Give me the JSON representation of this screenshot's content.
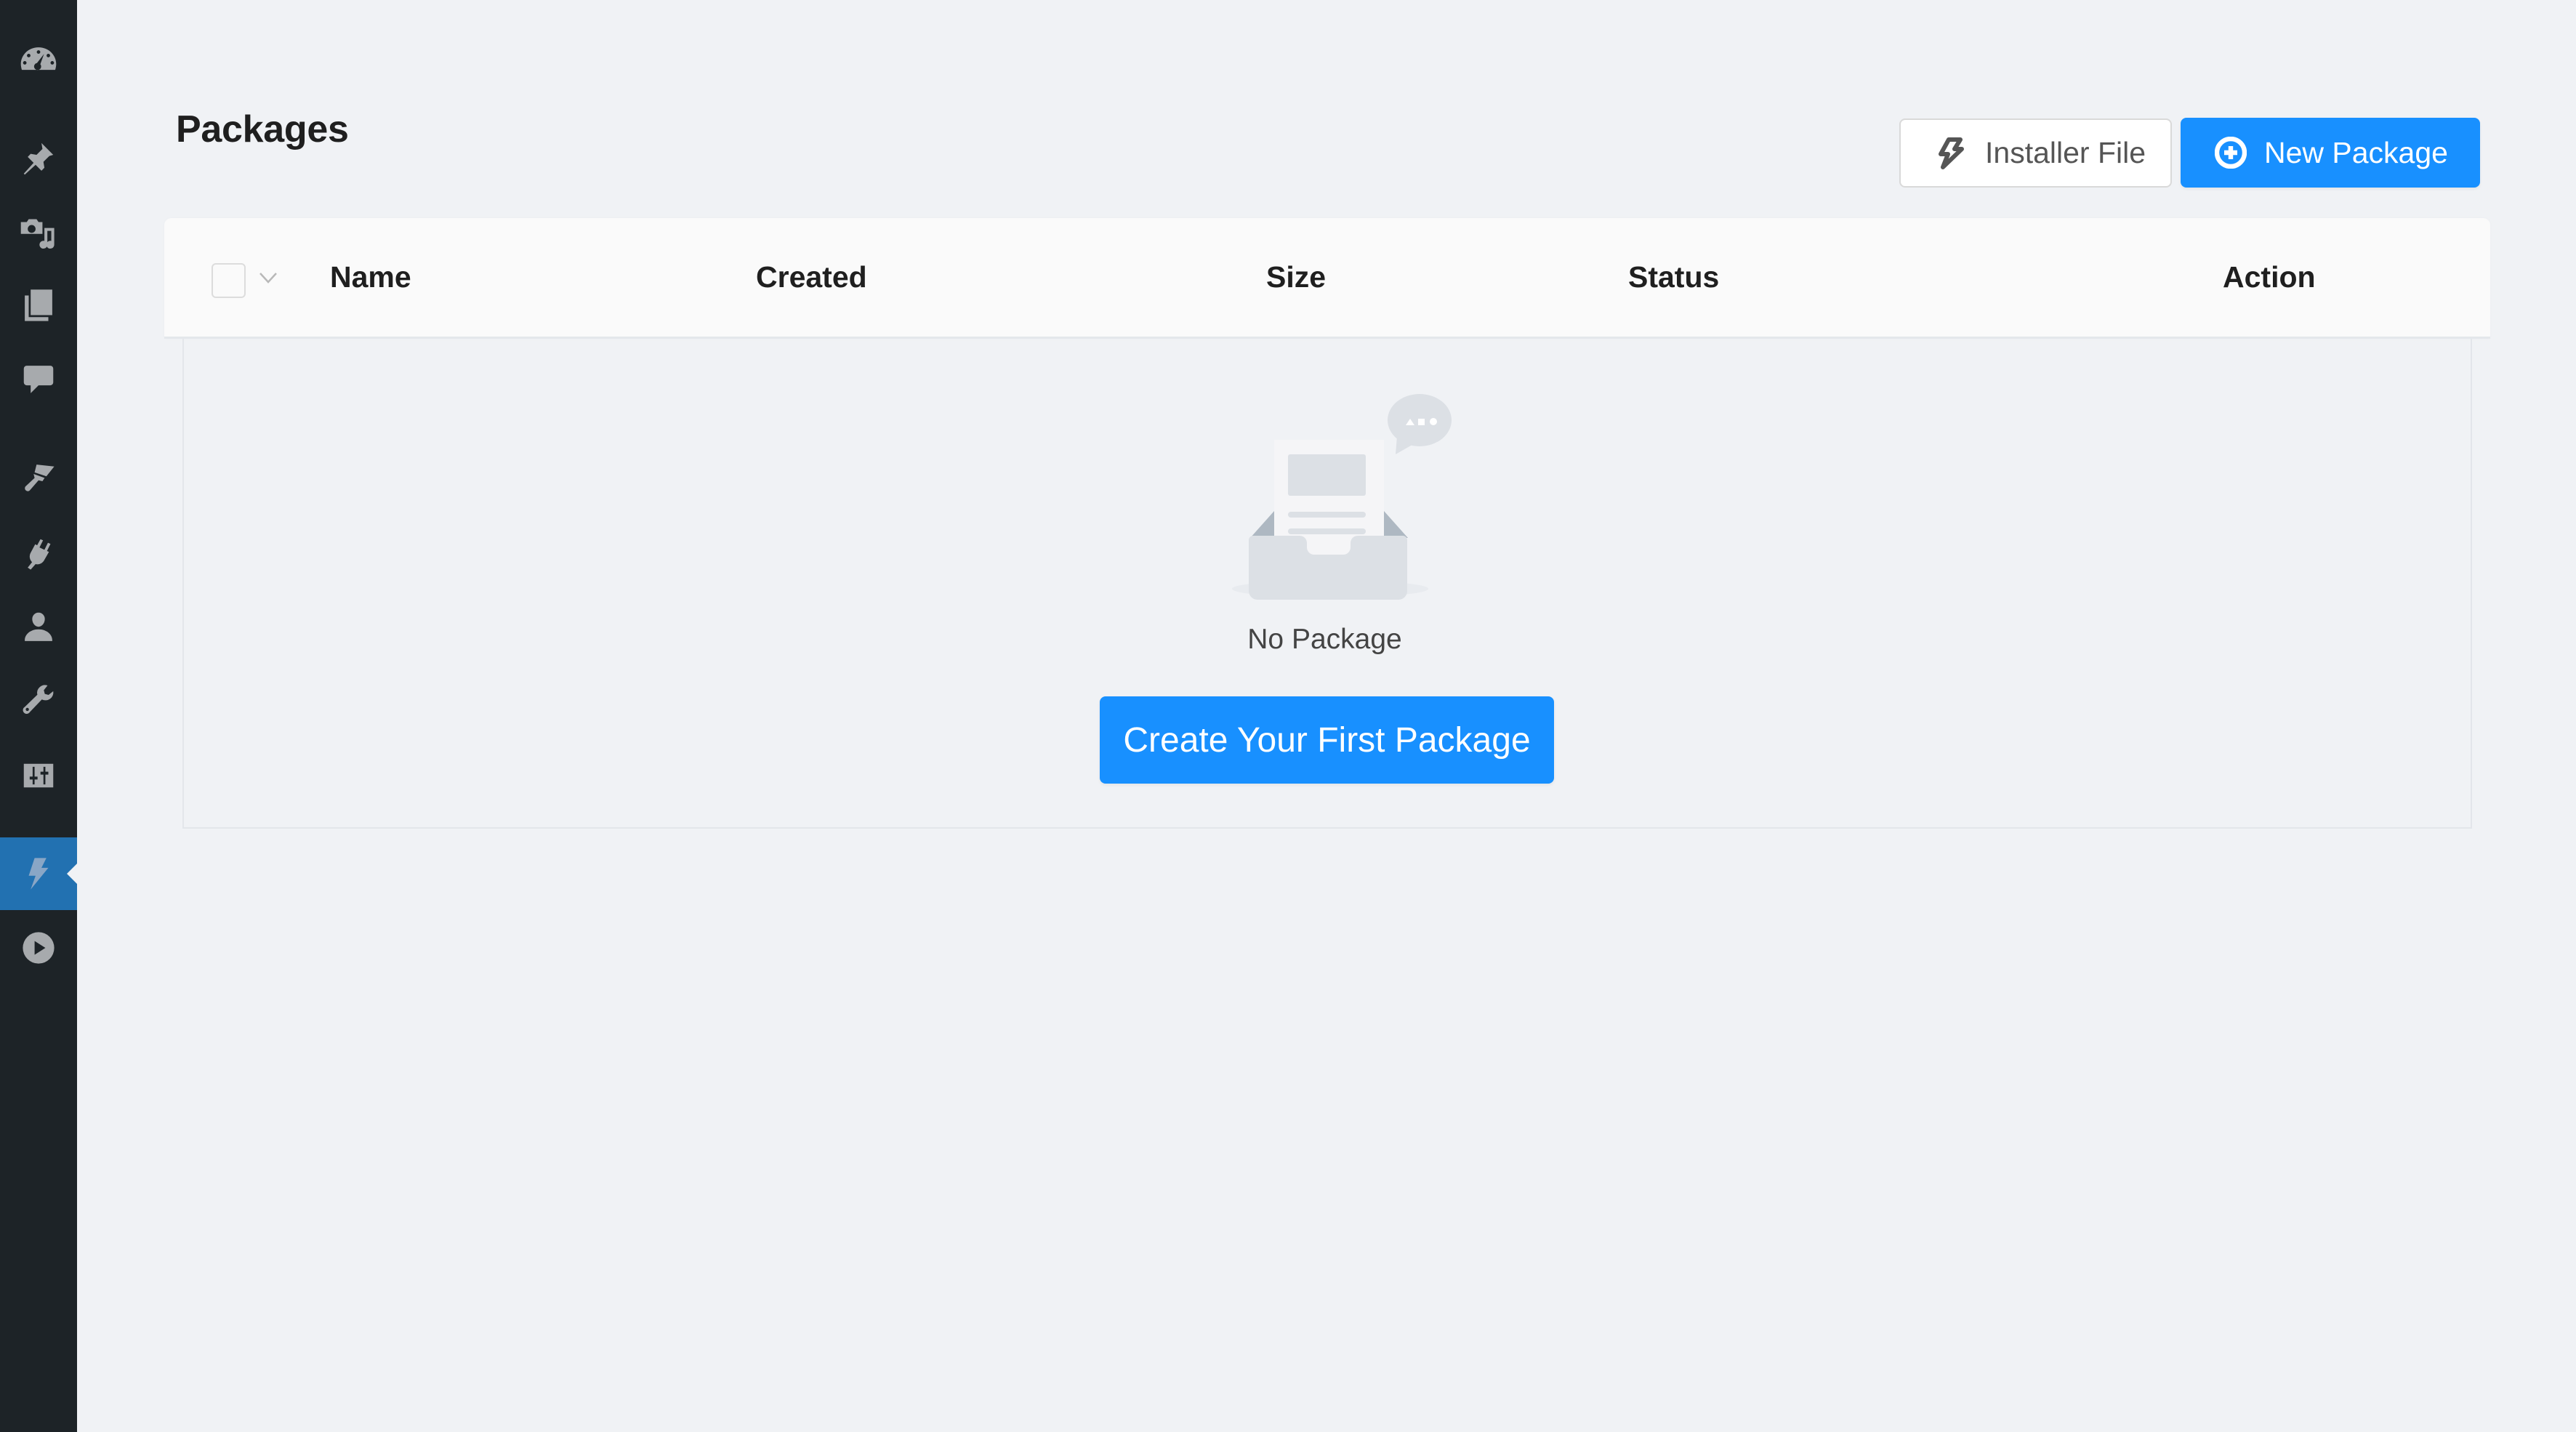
{
  "sidebar": {
    "items": [
      {
        "id": "dashboard",
        "icon": "dashboard-icon",
        "active": false
      },
      {
        "id": "posts",
        "icon": "pushpin-icon",
        "active": false
      },
      {
        "id": "media",
        "icon": "media-icon",
        "active": false
      },
      {
        "id": "pages",
        "icon": "pages-icon",
        "active": false
      },
      {
        "id": "comments",
        "icon": "comment-icon",
        "active": false
      },
      {
        "id": "appearance",
        "icon": "paintbrush-icon",
        "active": false
      },
      {
        "id": "plugins",
        "icon": "plugin-icon",
        "active": false
      },
      {
        "id": "users",
        "icon": "user-icon",
        "active": false
      },
      {
        "id": "tools",
        "icon": "wrench-icon",
        "active": false
      },
      {
        "id": "settings",
        "icon": "settings-sliders-icon",
        "active": false
      },
      {
        "id": "duplicator",
        "icon": "lightning-icon",
        "active": true
      },
      {
        "id": "media-player",
        "icon": "play-icon",
        "active": false
      }
    ]
  },
  "header": {
    "title": "Packages",
    "installer_button": {
      "label": "Installer File",
      "icon": "lightning-outline-icon"
    },
    "new_package_button": {
      "label": "New Package",
      "icon": "plus-circle-icon"
    }
  },
  "table": {
    "columns": [
      "Name",
      "Created",
      "Size",
      "Status",
      "Action"
    ],
    "rows": [],
    "select_all_checked": false
  },
  "empty_state": {
    "icon": "empty-inbox-icon",
    "message": "No Package",
    "cta_label": "Create Your First Package"
  },
  "colors": {
    "primary": "#1890ff",
    "sidebar_bg": "#1d2327",
    "sidebar_active": "#2271b1",
    "page_bg": "#f0f2f5"
  }
}
